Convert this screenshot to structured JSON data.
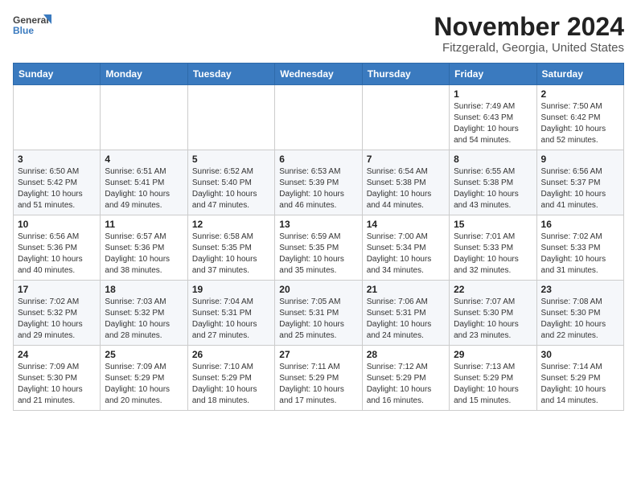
{
  "header": {
    "logo_line1": "General",
    "logo_line2": "Blue",
    "month": "November 2024",
    "location": "Fitzgerald, Georgia, United States"
  },
  "weekdays": [
    "Sunday",
    "Monday",
    "Tuesday",
    "Wednesday",
    "Thursday",
    "Friday",
    "Saturday"
  ],
  "weeks": [
    [
      {
        "day": "",
        "info": ""
      },
      {
        "day": "",
        "info": ""
      },
      {
        "day": "",
        "info": ""
      },
      {
        "day": "",
        "info": ""
      },
      {
        "day": "",
        "info": ""
      },
      {
        "day": "1",
        "info": "Sunrise: 7:49 AM\nSunset: 6:43 PM\nDaylight: 10 hours\nand 54 minutes."
      },
      {
        "day": "2",
        "info": "Sunrise: 7:50 AM\nSunset: 6:42 PM\nDaylight: 10 hours\nand 52 minutes."
      }
    ],
    [
      {
        "day": "3",
        "info": "Sunrise: 6:50 AM\nSunset: 5:42 PM\nDaylight: 10 hours\nand 51 minutes."
      },
      {
        "day": "4",
        "info": "Sunrise: 6:51 AM\nSunset: 5:41 PM\nDaylight: 10 hours\nand 49 minutes."
      },
      {
        "day": "5",
        "info": "Sunrise: 6:52 AM\nSunset: 5:40 PM\nDaylight: 10 hours\nand 47 minutes."
      },
      {
        "day": "6",
        "info": "Sunrise: 6:53 AM\nSunset: 5:39 PM\nDaylight: 10 hours\nand 46 minutes."
      },
      {
        "day": "7",
        "info": "Sunrise: 6:54 AM\nSunset: 5:38 PM\nDaylight: 10 hours\nand 44 minutes."
      },
      {
        "day": "8",
        "info": "Sunrise: 6:55 AM\nSunset: 5:38 PM\nDaylight: 10 hours\nand 43 minutes."
      },
      {
        "day": "9",
        "info": "Sunrise: 6:56 AM\nSunset: 5:37 PM\nDaylight: 10 hours\nand 41 minutes."
      }
    ],
    [
      {
        "day": "10",
        "info": "Sunrise: 6:56 AM\nSunset: 5:36 PM\nDaylight: 10 hours\nand 40 minutes."
      },
      {
        "day": "11",
        "info": "Sunrise: 6:57 AM\nSunset: 5:36 PM\nDaylight: 10 hours\nand 38 minutes."
      },
      {
        "day": "12",
        "info": "Sunrise: 6:58 AM\nSunset: 5:35 PM\nDaylight: 10 hours\nand 37 minutes."
      },
      {
        "day": "13",
        "info": "Sunrise: 6:59 AM\nSunset: 5:35 PM\nDaylight: 10 hours\nand 35 minutes."
      },
      {
        "day": "14",
        "info": "Sunrise: 7:00 AM\nSunset: 5:34 PM\nDaylight: 10 hours\nand 34 minutes."
      },
      {
        "day": "15",
        "info": "Sunrise: 7:01 AM\nSunset: 5:33 PM\nDaylight: 10 hours\nand 32 minutes."
      },
      {
        "day": "16",
        "info": "Sunrise: 7:02 AM\nSunset: 5:33 PM\nDaylight: 10 hours\nand 31 minutes."
      }
    ],
    [
      {
        "day": "17",
        "info": "Sunrise: 7:02 AM\nSunset: 5:32 PM\nDaylight: 10 hours\nand 29 minutes."
      },
      {
        "day": "18",
        "info": "Sunrise: 7:03 AM\nSunset: 5:32 PM\nDaylight: 10 hours\nand 28 minutes."
      },
      {
        "day": "19",
        "info": "Sunrise: 7:04 AM\nSunset: 5:31 PM\nDaylight: 10 hours\nand 27 minutes."
      },
      {
        "day": "20",
        "info": "Sunrise: 7:05 AM\nSunset: 5:31 PM\nDaylight: 10 hours\nand 25 minutes."
      },
      {
        "day": "21",
        "info": "Sunrise: 7:06 AM\nSunset: 5:31 PM\nDaylight: 10 hours\nand 24 minutes."
      },
      {
        "day": "22",
        "info": "Sunrise: 7:07 AM\nSunset: 5:30 PM\nDaylight: 10 hours\nand 23 minutes."
      },
      {
        "day": "23",
        "info": "Sunrise: 7:08 AM\nSunset: 5:30 PM\nDaylight: 10 hours\nand 22 minutes."
      }
    ],
    [
      {
        "day": "24",
        "info": "Sunrise: 7:09 AM\nSunset: 5:30 PM\nDaylight: 10 hours\nand 21 minutes."
      },
      {
        "day": "25",
        "info": "Sunrise: 7:09 AM\nSunset: 5:29 PM\nDaylight: 10 hours\nand 20 minutes."
      },
      {
        "day": "26",
        "info": "Sunrise: 7:10 AM\nSunset: 5:29 PM\nDaylight: 10 hours\nand 18 minutes."
      },
      {
        "day": "27",
        "info": "Sunrise: 7:11 AM\nSunset: 5:29 PM\nDaylight: 10 hours\nand 17 minutes."
      },
      {
        "day": "28",
        "info": "Sunrise: 7:12 AM\nSunset: 5:29 PM\nDaylight: 10 hours\nand 16 minutes."
      },
      {
        "day": "29",
        "info": "Sunrise: 7:13 AM\nSunset: 5:29 PM\nDaylight: 10 hours\nand 15 minutes."
      },
      {
        "day": "30",
        "info": "Sunrise: 7:14 AM\nSunset: 5:29 PM\nDaylight: 10 hours\nand 14 minutes."
      }
    ]
  ]
}
